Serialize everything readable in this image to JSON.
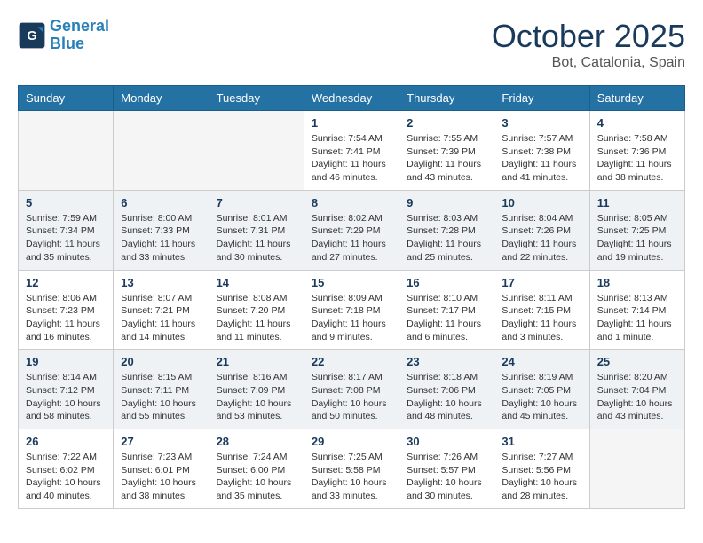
{
  "header": {
    "logo_line1": "General",
    "logo_line2": "Blue",
    "month": "October 2025",
    "location": "Bot, Catalonia, Spain"
  },
  "weekdays": [
    "Sunday",
    "Monday",
    "Tuesday",
    "Wednesday",
    "Thursday",
    "Friday",
    "Saturday"
  ],
  "weeks": [
    [
      {
        "day": "",
        "info": ""
      },
      {
        "day": "",
        "info": ""
      },
      {
        "day": "",
        "info": ""
      },
      {
        "day": "1",
        "info": "Sunrise: 7:54 AM\nSunset: 7:41 PM\nDaylight: 11 hours\nand 46 minutes."
      },
      {
        "day": "2",
        "info": "Sunrise: 7:55 AM\nSunset: 7:39 PM\nDaylight: 11 hours\nand 43 minutes."
      },
      {
        "day": "3",
        "info": "Sunrise: 7:57 AM\nSunset: 7:38 PM\nDaylight: 11 hours\nand 41 minutes."
      },
      {
        "day": "4",
        "info": "Sunrise: 7:58 AM\nSunset: 7:36 PM\nDaylight: 11 hours\nand 38 minutes."
      }
    ],
    [
      {
        "day": "5",
        "info": "Sunrise: 7:59 AM\nSunset: 7:34 PM\nDaylight: 11 hours\nand 35 minutes."
      },
      {
        "day": "6",
        "info": "Sunrise: 8:00 AM\nSunset: 7:33 PM\nDaylight: 11 hours\nand 33 minutes."
      },
      {
        "day": "7",
        "info": "Sunrise: 8:01 AM\nSunset: 7:31 PM\nDaylight: 11 hours\nand 30 minutes."
      },
      {
        "day": "8",
        "info": "Sunrise: 8:02 AM\nSunset: 7:29 PM\nDaylight: 11 hours\nand 27 minutes."
      },
      {
        "day": "9",
        "info": "Sunrise: 8:03 AM\nSunset: 7:28 PM\nDaylight: 11 hours\nand 25 minutes."
      },
      {
        "day": "10",
        "info": "Sunrise: 8:04 AM\nSunset: 7:26 PM\nDaylight: 11 hours\nand 22 minutes."
      },
      {
        "day": "11",
        "info": "Sunrise: 8:05 AM\nSunset: 7:25 PM\nDaylight: 11 hours\nand 19 minutes."
      }
    ],
    [
      {
        "day": "12",
        "info": "Sunrise: 8:06 AM\nSunset: 7:23 PM\nDaylight: 11 hours\nand 16 minutes."
      },
      {
        "day": "13",
        "info": "Sunrise: 8:07 AM\nSunset: 7:21 PM\nDaylight: 11 hours\nand 14 minutes."
      },
      {
        "day": "14",
        "info": "Sunrise: 8:08 AM\nSunset: 7:20 PM\nDaylight: 11 hours\nand 11 minutes."
      },
      {
        "day": "15",
        "info": "Sunrise: 8:09 AM\nSunset: 7:18 PM\nDaylight: 11 hours\nand 9 minutes."
      },
      {
        "day": "16",
        "info": "Sunrise: 8:10 AM\nSunset: 7:17 PM\nDaylight: 11 hours\nand 6 minutes."
      },
      {
        "day": "17",
        "info": "Sunrise: 8:11 AM\nSunset: 7:15 PM\nDaylight: 11 hours\nand 3 minutes."
      },
      {
        "day": "18",
        "info": "Sunrise: 8:13 AM\nSunset: 7:14 PM\nDaylight: 11 hours\nand 1 minute."
      }
    ],
    [
      {
        "day": "19",
        "info": "Sunrise: 8:14 AM\nSunset: 7:12 PM\nDaylight: 10 hours\nand 58 minutes."
      },
      {
        "day": "20",
        "info": "Sunrise: 8:15 AM\nSunset: 7:11 PM\nDaylight: 10 hours\nand 55 minutes."
      },
      {
        "day": "21",
        "info": "Sunrise: 8:16 AM\nSunset: 7:09 PM\nDaylight: 10 hours\nand 53 minutes."
      },
      {
        "day": "22",
        "info": "Sunrise: 8:17 AM\nSunset: 7:08 PM\nDaylight: 10 hours\nand 50 minutes."
      },
      {
        "day": "23",
        "info": "Sunrise: 8:18 AM\nSunset: 7:06 PM\nDaylight: 10 hours\nand 48 minutes."
      },
      {
        "day": "24",
        "info": "Sunrise: 8:19 AM\nSunset: 7:05 PM\nDaylight: 10 hours\nand 45 minutes."
      },
      {
        "day": "25",
        "info": "Sunrise: 8:20 AM\nSunset: 7:04 PM\nDaylight: 10 hours\nand 43 minutes."
      }
    ],
    [
      {
        "day": "26",
        "info": "Sunrise: 7:22 AM\nSunset: 6:02 PM\nDaylight: 10 hours\nand 40 minutes."
      },
      {
        "day": "27",
        "info": "Sunrise: 7:23 AM\nSunset: 6:01 PM\nDaylight: 10 hours\nand 38 minutes."
      },
      {
        "day": "28",
        "info": "Sunrise: 7:24 AM\nSunset: 6:00 PM\nDaylight: 10 hours\nand 35 minutes."
      },
      {
        "day": "29",
        "info": "Sunrise: 7:25 AM\nSunset: 5:58 PM\nDaylight: 10 hours\nand 33 minutes."
      },
      {
        "day": "30",
        "info": "Sunrise: 7:26 AM\nSunset: 5:57 PM\nDaylight: 10 hours\nand 30 minutes."
      },
      {
        "day": "31",
        "info": "Sunrise: 7:27 AM\nSunset: 5:56 PM\nDaylight: 10 hours\nand 28 minutes."
      },
      {
        "day": "",
        "info": ""
      }
    ]
  ]
}
